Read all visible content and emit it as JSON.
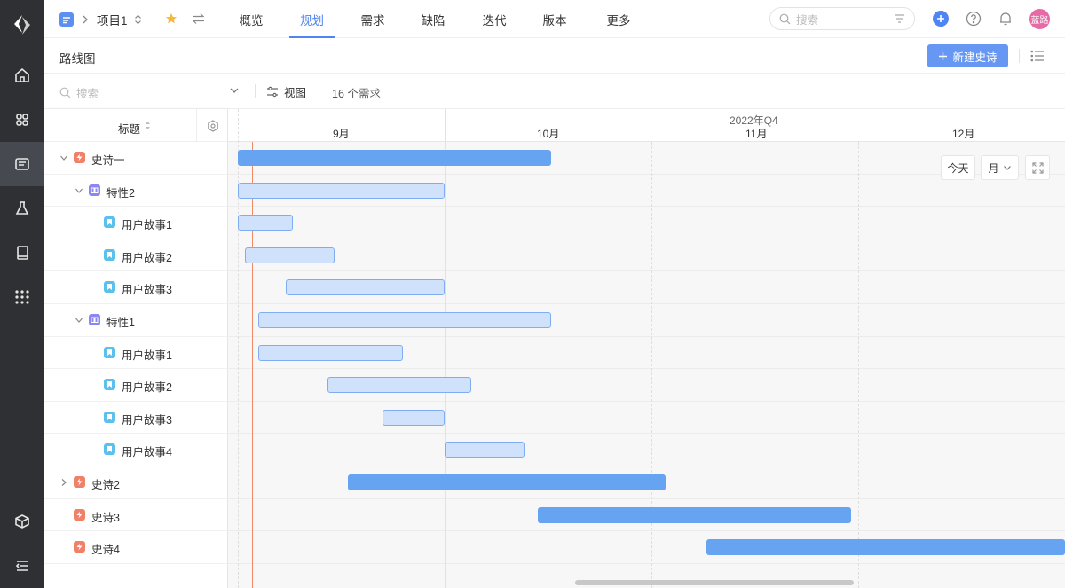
{
  "topbar": {
    "project_name": "项目1",
    "tabs": [
      {
        "label": "概览",
        "active": false
      },
      {
        "label": "规划",
        "active": true
      },
      {
        "label": "需求",
        "active": false
      },
      {
        "label": "缺陷",
        "active": false
      },
      {
        "label": "迭代",
        "active": false
      },
      {
        "label": "版本",
        "active": false
      },
      {
        "label": "更多",
        "active": false
      }
    ],
    "search_placeholder": "搜索",
    "avatar_text": "蓝路"
  },
  "page": {
    "title": "路线图",
    "new_button_label": "新建史诗"
  },
  "filter": {
    "search_placeholder": "搜索",
    "view_label": "视图",
    "count_text": "16 个需求"
  },
  "tree": {
    "header_label": "标题",
    "rows": [
      {
        "label": "史诗一",
        "type": "epic",
        "level": 0,
        "expand": "open"
      },
      {
        "label": "特性2",
        "type": "feature",
        "level": 1,
        "expand": "open"
      },
      {
        "label": "用户故事1",
        "type": "story",
        "level": 2,
        "expand": "none"
      },
      {
        "label": "用户故事2",
        "type": "story",
        "level": 2,
        "expand": "none"
      },
      {
        "label": "用户故事3",
        "type": "story",
        "level": 2,
        "expand": "none"
      },
      {
        "label": "特性1",
        "type": "feature",
        "level": 1,
        "expand": "open"
      },
      {
        "label": "用户故事1",
        "type": "story",
        "level": 2,
        "expand": "none"
      },
      {
        "label": "用户故事2",
        "type": "story",
        "level": 2,
        "expand": "none"
      },
      {
        "label": "用户故事3",
        "type": "story",
        "level": 2,
        "expand": "none"
      },
      {
        "label": "用户故事4",
        "type": "story",
        "level": 2,
        "expand": "none"
      },
      {
        "label": "史诗2",
        "type": "epic",
        "level": 0,
        "expand": "closed"
      },
      {
        "label": "史诗3",
        "type": "epic",
        "level": 0,
        "expand": "none"
      },
      {
        "label": "史诗4",
        "type": "epic",
        "level": 0,
        "expand": "none"
      }
    ]
  },
  "timeline": {
    "quarter_label": "2022年Q4",
    "months": [
      "9月",
      "10月",
      "11月",
      "12月"
    ],
    "today_label": "今天",
    "scale_label": "月",
    "bars": [
      {
        "row": 0,
        "start": "2022-08-26",
        "end": "2022-10-16",
        "kind": "epic"
      },
      {
        "row": 1,
        "start": "2022-08-26",
        "end": "2022-09-30",
        "kind": "sub"
      },
      {
        "row": 2,
        "start": "2022-08-26",
        "end": "2022-09-08",
        "kind": "sub"
      },
      {
        "row": 3,
        "start": "2022-09-02",
        "end": "2022-09-14",
        "kind": "sub"
      },
      {
        "row": 4,
        "start": "2022-09-08",
        "end": "2022-09-30",
        "kind": "sub"
      },
      {
        "row": 5,
        "start": "2022-09-04",
        "end": "2022-10-16",
        "kind": "sub"
      },
      {
        "row": 6,
        "start": "2022-09-04",
        "end": "2022-09-24",
        "kind": "sub"
      },
      {
        "row": 7,
        "start": "2022-09-14",
        "end": "2022-10-04",
        "kind": "sub"
      },
      {
        "row": 8,
        "start": "2022-09-22",
        "end": "2022-09-30",
        "kind": "sub"
      },
      {
        "row": 9,
        "start": "2022-10-01",
        "end": "2022-10-12",
        "kind": "sub"
      },
      {
        "row": 10,
        "start": "2022-09-17",
        "end": "2022-11-02",
        "kind": "epic"
      },
      {
        "row": 11,
        "start": "2022-10-15",
        "end": "2022-11-29",
        "kind": "epic"
      },
      {
        "row": 12,
        "start": "2022-11-09",
        "end": "2022-12-31",
        "kind": "epic"
      }
    ],
    "today_date": "2022-09-03"
  },
  "colors": {
    "accent": "#4f85f2",
    "epic_bar": "#66a3f0",
    "sub_bar": "#cfe1fb",
    "today_line": "#f08a6a",
    "epic_icon": "#f0806a",
    "feature_icon": "#8c87f0",
    "story_icon": "#5bc0eb"
  }
}
